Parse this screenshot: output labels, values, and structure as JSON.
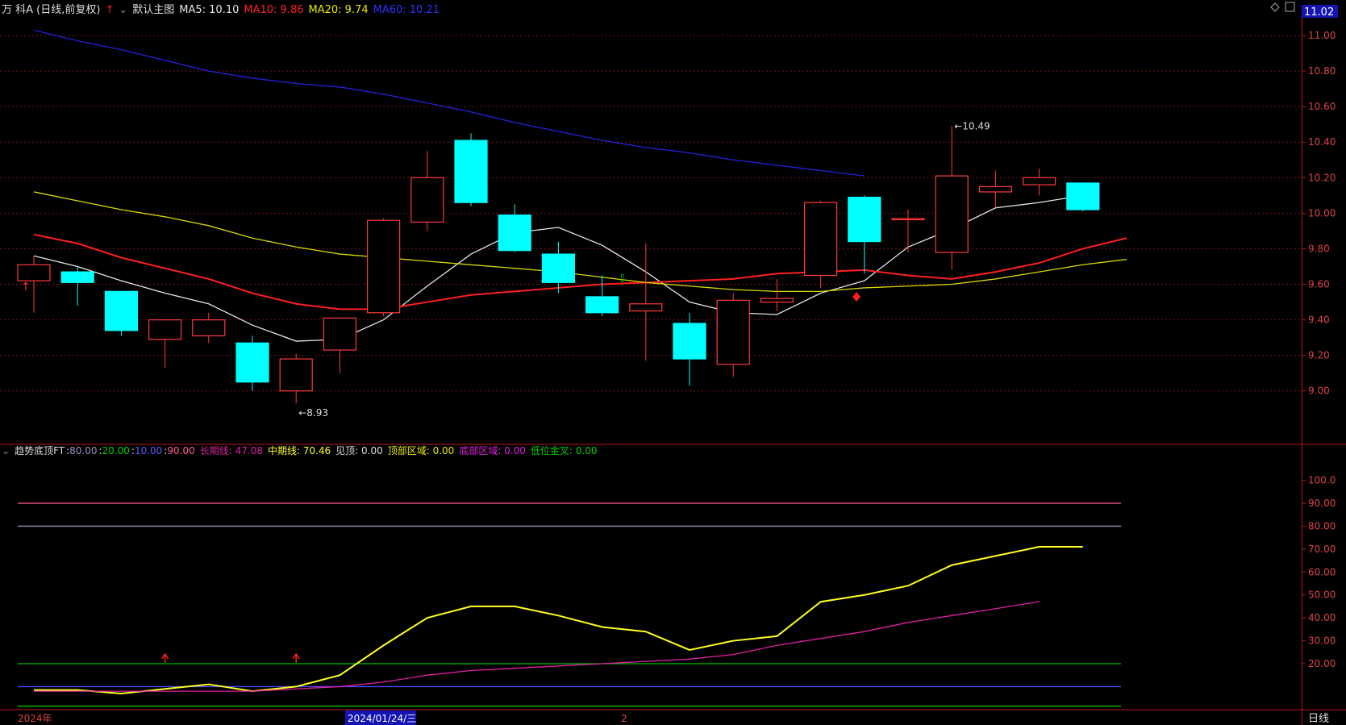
{
  "header": {
    "stock_name": "万 科A (日线,前复权)",
    "main_chart_label": "默认主图",
    "ma5": "MA5: 10.10",
    "ma10": "MA10: 9.86",
    "ma20": "MA20: 9.74",
    "ma60": "MA60: 10.21",
    "last_price": "11.02"
  },
  "indicator_header": {
    "name": "趋势底顶FT",
    "p1": "80.00",
    "p2": "20.00",
    "p3": "10.00",
    "p4": "90.00",
    "long_line": "长期线: 47.08",
    "mid_line": "中期线: 70.46",
    "top_signal": "见顶: 0.00",
    "top_zone": "顶部区域: 0.00",
    "bottom_zone": "底部区域: 0.00",
    "low_cross": "低位金叉: 0.00"
  },
  "footer": {
    "year_label": "2024年",
    "date_label": "2024/01/24/三",
    "month_label": "2",
    "period_button": "日线"
  },
  "chart_data": [
    {
      "type": "candlestick",
      "y_ticks": [
        "11.00",
        "10.80",
        "10.60",
        "10.40",
        "10.20",
        "10.00",
        "9.80",
        "9.60",
        "9.40",
        "9.20",
        "9.00"
      ],
      "ylim": [
        8.84,
        11.1
      ],
      "candles": [
        {
          "o": 9.62,
          "h": 9.76,
          "l": 9.44,
          "c": 9.71
        },
        {
          "o": 9.67,
          "h": 9.7,
          "l": 9.48,
          "c": 9.61
        },
        {
          "o": 9.56,
          "h": 9.56,
          "l": 9.31,
          "c": 9.34
        },
        {
          "o": 9.29,
          "h": 9.4,
          "l": 9.13,
          "c": 9.4
        },
        {
          "o": 9.31,
          "h": 9.44,
          "l": 9.27,
          "c": 9.4
        },
        {
          "o": 9.27,
          "h": 9.31,
          "l": 9.0,
          "c": 9.05
        },
        {
          "o": 9.0,
          "h": 9.21,
          "l": 8.93,
          "c": 9.18
        },
        {
          "o": 9.23,
          "h": 9.4,
          "l": 9.1,
          "c": 9.41
        },
        {
          "o": 9.44,
          "h": 9.97,
          "l": 9.42,
          "c": 9.96
        },
        {
          "o": 9.95,
          "h": 10.35,
          "l": 9.9,
          "c": 10.2
        },
        {
          "o": 10.41,
          "h": 10.45,
          "l": 10.04,
          "c": 10.06
        },
        {
          "o": 9.99,
          "h": 10.05,
          "l": 9.78,
          "c": 9.79
        },
        {
          "o": 9.77,
          "h": 9.84,
          "l": 9.55,
          "c": 9.61
        },
        {
          "o": 9.53,
          "h": 9.65,
          "l": 9.42,
          "c": 9.44
        },
        {
          "o": 9.45,
          "h": 9.83,
          "l": 9.17,
          "c": 9.49
        },
        {
          "o": 9.38,
          "h": 9.44,
          "l": 9.03,
          "c": 9.18
        },
        {
          "o": 9.15,
          "h": 9.55,
          "l": 9.08,
          "c": 9.51
        },
        {
          "o": 9.5,
          "h": 9.63,
          "l": 9.45,
          "c": 9.52
        },
        {
          "o": 9.65,
          "h": 10.07,
          "l": 9.58,
          "c": 10.06
        },
        {
          "o": 10.09,
          "h": 10.1,
          "l": 9.66,
          "c": 9.84
        },
        {
          "o": 9.97,
          "h": 10.02,
          "l": 9.78,
          "c": 9.97
        },
        {
          "o": 9.78,
          "h": 10.49,
          "l": 9.68,
          "c": 10.21
        },
        {
          "o": 10.12,
          "h": 10.24,
          "l": 10.03,
          "c": 10.15
        },
        {
          "o": 10.16,
          "h": 10.25,
          "l": 10.1,
          "c": 10.2
        },
        {
          "o": 10.17,
          "h": 10.17,
          "l": 10.01,
          "c": 10.02
        }
      ],
      "series": [
        {
          "name": "MA5",
          "color": "#e6e6e6",
          "values": [
            9.76,
            9.7,
            9.62,
            9.55,
            9.49,
            9.37,
            9.28,
            9.29,
            9.4,
            9.59,
            9.77,
            9.89,
            9.92,
            9.82,
            9.67,
            9.5,
            9.44,
            9.43,
            9.55,
            9.62,
            9.81,
            9.91,
            10.03,
            10.06,
            10.1
          ]
        },
        {
          "name": "MA10",
          "color": "#ff2020",
          "values": [
            9.88,
            9.83,
            9.75,
            9.69,
            9.63,
            9.55,
            9.49,
            9.46,
            9.46,
            9.5,
            9.54,
            9.56,
            9.58,
            9.6,
            9.61,
            9.62,
            9.63,
            9.66,
            9.67,
            9.68,
            9.65,
            9.63,
            9.67,
            9.72,
            9.8,
            9.86
          ]
        },
        {
          "name": "MA20",
          "color": "#d8d800",
          "values": [
            10.12,
            10.07,
            10.02,
            9.98,
            9.93,
            9.86,
            9.81,
            9.77,
            9.75,
            9.73,
            9.71,
            9.69,
            9.67,
            9.64,
            9.61,
            9.59,
            9.57,
            9.56,
            9.56,
            9.58,
            9.59,
            9.6,
            9.63,
            9.67,
            9.71,
            9.74
          ]
        },
        {
          "name": "MA60",
          "color": "#2222dd",
          "values": [
            11.03,
            10.97,
            10.92,
            10.86,
            10.8,
            10.76,
            10.73,
            10.71,
            10.67,
            10.62,
            10.57,
            10.51,
            10.46,
            10.41,
            10.37,
            10.34,
            10.3,
            10.27,
            10.24,
            10.21
          ]
        }
      ],
      "annotations": [
        {
          "text": "10.49",
          "candle": 21,
          "value": 10.49
        },
        {
          "text": "8.93",
          "candle": 6,
          "value": 8.93
        }
      ]
    },
    {
      "type": "line",
      "title": "趋势底顶FT",
      "y_ticks": [
        "100.0",
        "90.00",
        "80.00",
        "70.00",
        "60.00",
        "50.00",
        "40.00",
        "30.00",
        "20.00"
      ],
      "ylim": [
        1.0,
        109.0
      ],
      "reference_lines": [
        {
          "value": 90,
          "color": "#ff6090"
        },
        {
          "value": 80,
          "color": "#a090c0"
        },
        {
          "value": 20,
          "color": "#00c000"
        },
        {
          "value": 10,
          "color": "#4a4aff"
        },
        {
          "value": 1.5,
          "color": "#00c000"
        }
      ],
      "series": [
        {
          "name": "中期线",
          "color": "#ffff20",
          "values": [
            8.5,
            8.5,
            7,
            9,
            11,
            8,
            10,
            15,
            28,
            40,
            45,
            45,
            41,
            36,
            34,
            26,
            30,
            32,
            47,
            50,
            54,
            63,
            67,
            71,
            71
          ]
        },
        {
          "name": "长期线",
          "color": "#e020a0",
          "values": [
            8,
            8,
            8,
            8,
            8,
            8,
            9,
            10,
            12,
            15,
            17,
            18,
            19,
            20,
            21,
            22,
            24,
            28,
            31,
            34,
            38,
            41,
            44,
            47.08
          ]
        }
      ],
      "markers": [
        3,
        6
      ]
    }
  ]
}
